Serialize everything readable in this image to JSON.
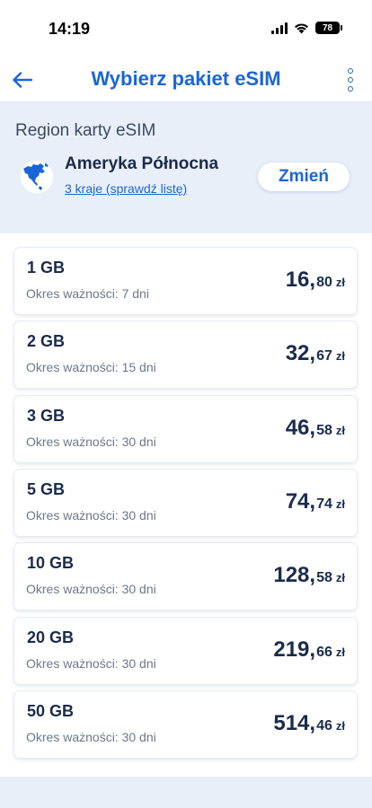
{
  "status": {
    "time": "14:19",
    "battery": "78"
  },
  "nav": {
    "title": "Wybierz pakiet eSIM"
  },
  "region": {
    "label": "Region karty eSIM",
    "name": "Ameryka Północna",
    "countries_link": "3 kraje (sprawdź listę)",
    "change_button": "Zmień"
  },
  "packages": [
    {
      "size": "1 GB",
      "validity": "Okres ważności: 7 dni",
      "price_int": "16",
      "price_dec": "80",
      "currency": "zł"
    },
    {
      "size": "2 GB",
      "validity": "Okres ważności: 15 dni",
      "price_int": "32",
      "price_dec": "67",
      "currency": "zł"
    },
    {
      "size": "3 GB",
      "validity": "Okres ważności: 30 dni",
      "price_int": "46",
      "price_dec": "58",
      "currency": "zł"
    },
    {
      "size": "5 GB",
      "validity": "Okres ważności: 30 dni",
      "price_int": "74",
      "price_dec": "74",
      "currency": "zł"
    },
    {
      "size": "10 GB",
      "validity": "Okres ważności: 30 dni",
      "price_int": "128",
      "price_dec": "58",
      "currency": "zł"
    },
    {
      "size": "20 GB",
      "validity": "Okres ważności: 30 dni",
      "price_int": "219",
      "price_dec": "66",
      "currency": "zł"
    },
    {
      "size": "50 GB",
      "validity": "Okres ważności: 30 dni",
      "price_int": "514",
      "price_dec": "46",
      "currency": "zł"
    }
  ],
  "colors": {
    "accent": "#1a66d8",
    "text_dark": "#1a2b4c",
    "background": "#e9eff8"
  }
}
